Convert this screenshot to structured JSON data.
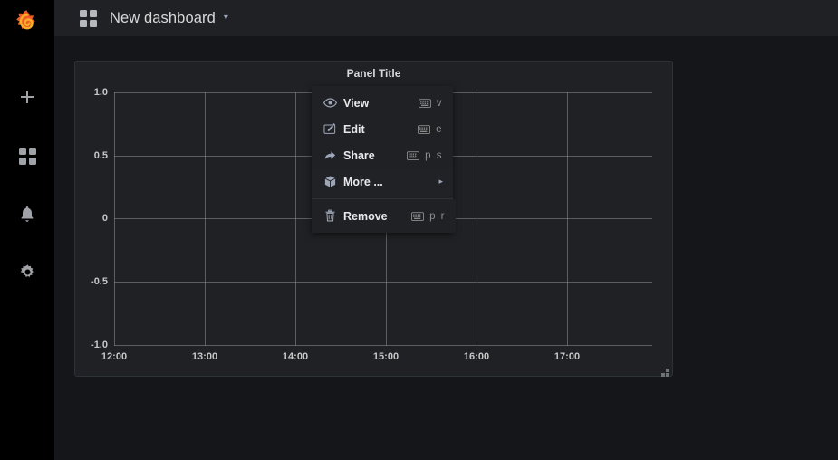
{
  "app": {
    "logo_icon": "grafana-logo-icon",
    "brand_colors": {
      "logo_outer": "#f05a28",
      "logo_inner": "#fbad26",
      "accent": "#ff8800"
    }
  },
  "sidebar": {
    "items": [
      {
        "icon": "plus-icon",
        "name": "create"
      },
      {
        "icon": "dashboards-grid-icon",
        "name": "dashboards"
      },
      {
        "icon": "bell-icon",
        "name": "alerting"
      },
      {
        "icon": "gear-icon",
        "name": "configuration"
      }
    ]
  },
  "topbar": {
    "grid_icon": "dashboard-grid-icon",
    "title": "New dashboard",
    "caret": "▾"
  },
  "panel": {
    "title": "Panel Title",
    "resize_handle_icon": "resize-handle-icon"
  },
  "context_menu": {
    "groups": [
      {
        "items": [
          {
            "icon": "eye-icon",
            "label": "View",
            "keys": "v",
            "kbd_icon": "keyboard-icon"
          },
          {
            "icon": "pencil-box-icon",
            "label": "Edit",
            "keys": "e",
            "kbd_icon": "keyboard-icon"
          },
          {
            "icon": "share-arrow-icon",
            "label": "Share",
            "keys": "p s",
            "kbd_icon": "keyboard-icon"
          },
          {
            "icon": "cube-icon",
            "label": "More ...",
            "arrow": "▸"
          }
        ]
      },
      {
        "items": [
          {
            "icon": "trash-icon",
            "label": "Remove",
            "keys": "p r",
            "kbd_icon": "keyboard-icon"
          }
        ]
      }
    ]
  },
  "chart_data": {
    "type": "line",
    "title": "Panel Title",
    "series": [],
    "x": [
      "12:00",
      "13:00",
      "14:00",
      "15:00",
      "16:00",
      "17:00"
    ],
    "xlabel": "",
    "ylabel": "",
    "xticks": [
      "12:00",
      "13:00",
      "14:00",
      "15:00",
      "16:00",
      "17:00"
    ],
    "yticks": [
      "1.0",
      "0.5",
      "0",
      "-0.5",
      "-1.0"
    ],
    "ylim": [
      -1.0,
      1.0
    ],
    "grid": true,
    "legend": "none",
    "note": "Empty panel — no data series plotted, only axes and grid shown"
  }
}
